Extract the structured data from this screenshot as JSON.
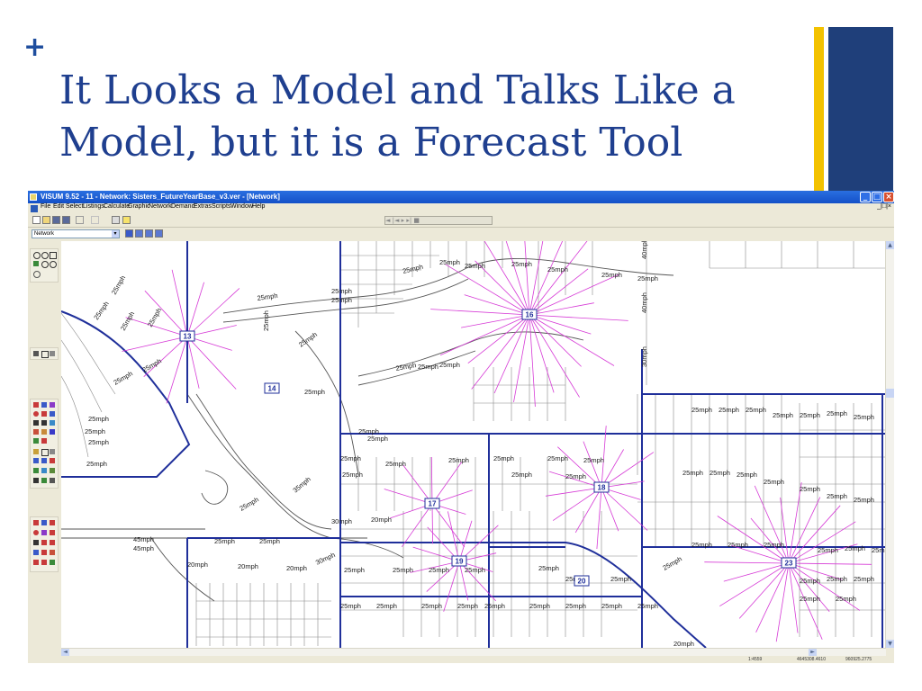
{
  "slide": {
    "bullet": "+",
    "title": "It Looks a Model and Talks Like a Model, but it is a Forecast Tool",
    "accent_colors": {
      "gold": "#f3c200",
      "navy": "#1f3f7a"
    }
  },
  "app": {
    "title": "VISUM 9.52 - 11  - Network: Sisters_FutureYearBase_v3.ver - [Network]",
    "window_buttons": {
      "minimize": "_",
      "maximize": "□",
      "close": "×"
    },
    "menu": [
      "File",
      "Edit",
      "Select",
      "Listings",
      "Calculate",
      "Graphic",
      "Network",
      "Demand",
      "Extras",
      "Scripts",
      "Window",
      "Help"
    ],
    "mdi_buttons": "_|□|×",
    "toolbar_icons": [
      "new-icon",
      "open-icon",
      "save-icon",
      "save-as-icon",
      "undo-icon",
      "redo-icon",
      "print-icon",
      "help-icon"
    ],
    "timeline_controls": "◄ |◄  ▸ ▸| ■",
    "view_icons": [
      "net-view-icon",
      "list-view-icon",
      "table-view-icon",
      "graphic-view-icon"
    ],
    "network_selector": {
      "value": "Network",
      "arrow": "▾"
    },
    "tool_groups": [
      "zoom-tools",
      "network-object-tools",
      "edit-tools",
      "graphic-tools"
    ],
    "scroll": {
      "up": "▲",
      "down": "▼",
      "left": "◄",
      "right": "►"
    },
    "status": {
      "scale": "1:4559",
      "x": "4645308.4610",
      "y": "960925.2775"
    }
  },
  "map": {
    "speed_label": "25mph",
    "zones": [
      "13",
      "14",
      "16",
      "17",
      "18",
      "19",
      "20",
      "23"
    ],
    "road_labels": [
      "25mph",
      "20mph",
      "30mph",
      "35mph",
      "40mph",
      "45mph"
    ],
    "link_colors": {
      "major": "#1f2f9a",
      "connector": "#d63ad6",
      "local": "#555555",
      "parcel": "#7a7a7a"
    }
  }
}
